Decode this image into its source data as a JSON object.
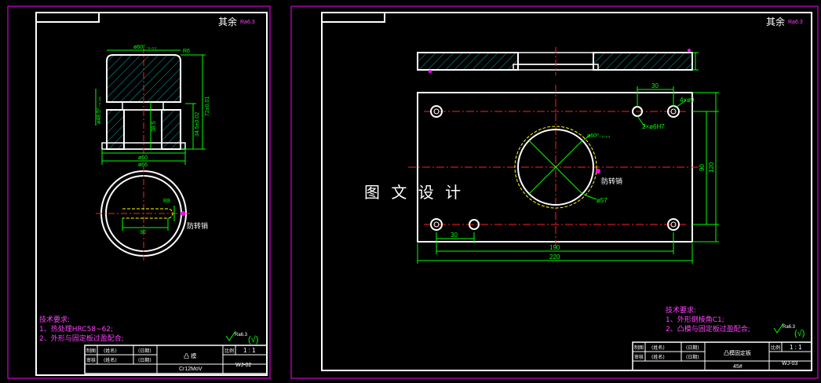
{
  "watermark": "图 文 设 计",
  "colors": {
    "frame": "#ffffff",
    "dim": "#00ff00",
    "center": "#ff2020",
    "note": "#ff40ff",
    "hatch": "#00aaaa",
    "sheet": "#ff00ff"
  },
  "left_sheet": {
    "roughness": "其余",
    "roughness_value": "Ra6.3",
    "dims": {
      "top_dia": "ø60⁰₋₀.₀₃",
      "radius": "R6",
      "height": "72±0.01",
      "mid_height": "34.5±0.02",
      "left_dia": "ø48.5⁰₋₀.₀₅",
      "bore_depth": "38.5",
      "base_dia": "ø60",
      "outer_dia": "ø66",
      "pin_r": "R8",
      "pin_w": "30"
    },
    "pin_label": "防转销",
    "notes_title": "技术要求:",
    "notes": [
      "1、热处理HRC58~62;",
      "2、外形与固定板过盈配合;"
    ],
    "title_block": {
      "r1": [
        "制图",
        "(姓名)",
        "(日期)"
      ],
      "r2": [
        "审核",
        "(姓名)",
        "(日期)"
      ],
      "name": "凸 模",
      "material": "Cr12MoV",
      "scale_label": "比例",
      "scale": "1 : 1",
      "code": "WJ-02"
    }
  },
  "right_sheet": {
    "roughness": "其余",
    "roughness_value": "Ra6.3",
    "dims": {
      "d30_top": "30",
      "holes": "4×ø9",
      "pinholes": "2×ø6H7",
      "bore": "ø60⁰₋₀.₀₃",
      "bore2": "ø57",
      "h90": "90",
      "h120": "120",
      "d30_bot": "30",
      "w190": "190",
      "w220": "220"
    },
    "pin_label": "防转销",
    "notes_title": "技术要求:",
    "notes": [
      "1、外形倒棱角C1;",
      "2、凸模与固定板过盈配合;"
    ],
    "title_block": {
      "r1": [
        "制图",
        "(姓名)",
        "(日期)"
      ],
      "r2": [
        "审核",
        "(姓名)",
        "(日期)"
      ],
      "name": "凸模固定板",
      "material": "45#",
      "scale_label": "比例",
      "scale": "1 : 1",
      "code": "WJ-03"
    }
  }
}
